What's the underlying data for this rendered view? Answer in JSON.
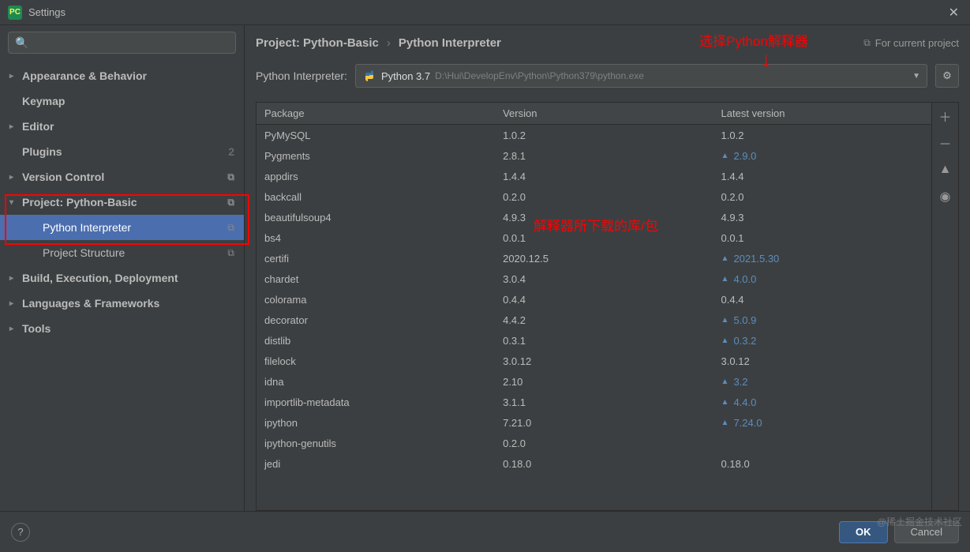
{
  "titlebar": {
    "title": "Settings",
    "iconText": "PC"
  },
  "search": {
    "placeholder": ""
  },
  "tree": {
    "items": [
      {
        "label": "Appearance & Behavior",
        "hasChildren": true,
        "expanded": false
      },
      {
        "label": "Keymap",
        "hasChildren": false
      },
      {
        "label": "Editor",
        "hasChildren": true,
        "expanded": false
      },
      {
        "label": "Plugins",
        "hasChildren": false,
        "badge": "2"
      },
      {
        "label": "Version Control",
        "hasChildren": true,
        "expanded": false,
        "copyIcon": true
      },
      {
        "label": "Project: Python-Basic",
        "hasChildren": true,
        "expanded": true,
        "copyIcon": true,
        "children": [
          {
            "label": "Python Interpreter",
            "selected": true,
            "copyIcon": true
          },
          {
            "label": "Project Structure",
            "copyIcon": true
          }
        ]
      },
      {
        "label": "Build, Execution, Deployment",
        "hasChildren": true,
        "expanded": false
      },
      {
        "label": "Languages & Frameworks",
        "hasChildren": true,
        "expanded": false
      },
      {
        "label": "Tools",
        "hasChildren": true,
        "expanded": false
      }
    ]
  },
  "breadcrumb": {
    "part1": "Project: Python-Basic",
    "part2": "Python Interpreter",
    "sep": "›",
    "current": "For current project"
  },
  "interpreter": {
    "label": "Python Interpreter:",
    "name": "Python 3.7",
    "path": "D:\\Hui\\DevelopEnv\\Python\\Python379\\python.exe"
  },
  "table": {
    "headers": {
      "pkg": "Package",
      "ver": "Version",
      "latest": "Latest version"
    },
    "rows": [
      {
        "pkg": "PyMySQL",
        "ver": "1.0.2",
        "latest": "1.0.2",
        "update": false
      },
      {
        "pkg": "Pygments",
        "ver": "2.8.1",
        "latest": "2.9.0",
        "update": true
      },
      {
        "pkg": "appdirs",
        "ver": "1.4.4",
        "latest": "1.4.4",
        "update": false
      },
      {
        "pkg": "backcall",
        "ver": "0.2.0",
        "latest": "0.2.0",
        "update": false
      },
      {
        "pkg": "beautifulsoup4",
        "ver": "4.9.3",
        "latest": "4.9.3",
        "update": false
      },
      {
        "pkg": "bs4",
        "ver": "0.0.1",
        "latest": "0.0.1",
        "update": false
      },
      {
        "pkg": "certifi",
        "ver": "2020.12.5",
        "latest": "2021.5.30",
        "update": true
      },
      {
        "pkg": "chardet",
        "ver": "3.0.4",
        "latest": "4.0.0",
        "update": true
      },
      {
        "pkg": "colorama",
        "ver": "0.4.4",
        "latest": "0.4.4",
        "update": false
      },
      {
        "pkg": "decorator",
        "ver": "4.4.2",
        "latest": "5.0.9",
        "update": true
      },
      {
        "pkg": "distlib",
        "ver": "0.3.1",
        "latest": "0.3.2",
        "update": true
      },
      {
        "pkg": "filelock",
        "ver": "3.0.12",
        "latest": "3.0.12",
        "update": false
      },
      {
        "pkg": "idna",
        "ver": "2.10",
        "latest": "3.2",
        "update": true
      },
      {
        "pkg": "importlib-metadata",
        "ver": "3.1.1",
        "latest": "4.4.0",
        "update": true
      },
      {
        "pkg": "ipython",
        "ver": "7.21.0",
        "latest": "7.24.0",
        "update": true
      },
      {
        "pkg": "ipython-genutils",
        "ver": "0.2.0",
        "latest": "",
        "update": false
      },
      {
        "pkg": "jedi",
        "ver": "0.18.0",
        "latest": "0.18.0",
        "update": false
      }
    ]
  },
  "annotations": {
    "a1": "选择Python解释器",
    "a2": "解释器所下载的库/包",
    "arrow": "↓"
  },
  "footer": {
    "ok": "OK",
    "cancel": "Cancel",
    "help": "?"
  },
  "watermark": "@稀土掘金技术社区"
}
